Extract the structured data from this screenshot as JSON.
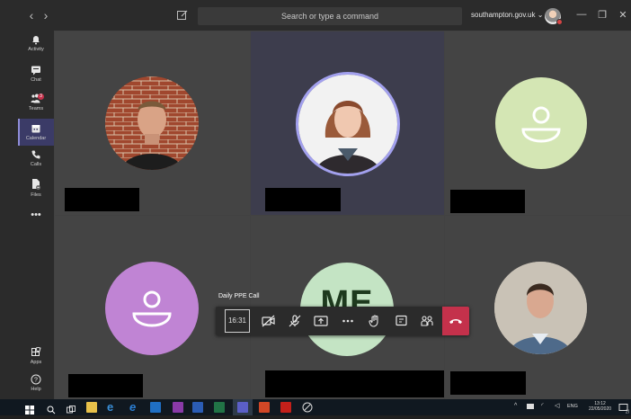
{
  "titlebar": {
    "search_placeholder": "Search or type a command",
    "org": "southampton.gov.uk",
    "org_chevron": "⌄"
  },
  "rail": {
    "items": [
      {
        "label": "Activity",
        "icon": "bell-icon"
      },
      {
        "label": "Chat",
        "icon": "chat-icon"
      },
      {
        "label": "Teams",
        "icon": "teams-icon",
        "badge": "3"
      },
      {
        "label": "Calendar",
        "icon": "calendar-icon",
        "active": true
      },
      {
        "label": "Calls",
        "icon": "phone-icon"
      },
      {
        "label": "Files",
        "icon": "files-icon"
      },
      {
        "label": "•••",
        "icon": "more-icon"
      }
    ],
    "bottom": [
      {
        "label": "Apps",
        "icon": "apps-icon"
      },
      {
        "label": "Help",
        "icon": "help-icon"
      }
    ]
  },
  "grid": {
    "participants": [
      {
        "tile": "1",
        "type": "photo"
      },
      {
        "tile": "2",
        "type": "photo",
        "speaking": true
      },
      {
        "tile": "3",
        "type": "default-avatar",
        "color": "#d4e6b4"
      },
      {
        "tile": "4",
        "type": "default-avatar",
        "color": "#c084d4"
      },
      {
        "tile": "5",
        "type": "initials",
        "initials": "ME",
        "color": "#c4e4c4"
      },
      {
        "tile": "6",
        "type": "photo"
      }
    ]
  },
  "call": {
    "meeting_title": "Daily PPE Call",
    "timer": "16:31",
    "controls": [
      "camera-off-icon",
      "mic-off-icon",
      "share-screen-icon",
      "more-icon",
      "raise-hand-icon",
      "chat-icon",
      "participants-icon",
      "hang-up-icon"
    ],
    "accent": "#6264a7",
    "hangup_color": "#c4314b"
  },
  "taskbar": {
    "lang": "ENG",
    "time": "13:12",
    "date": "22/05/2020",
    "notification_count": "20"
  }
}
